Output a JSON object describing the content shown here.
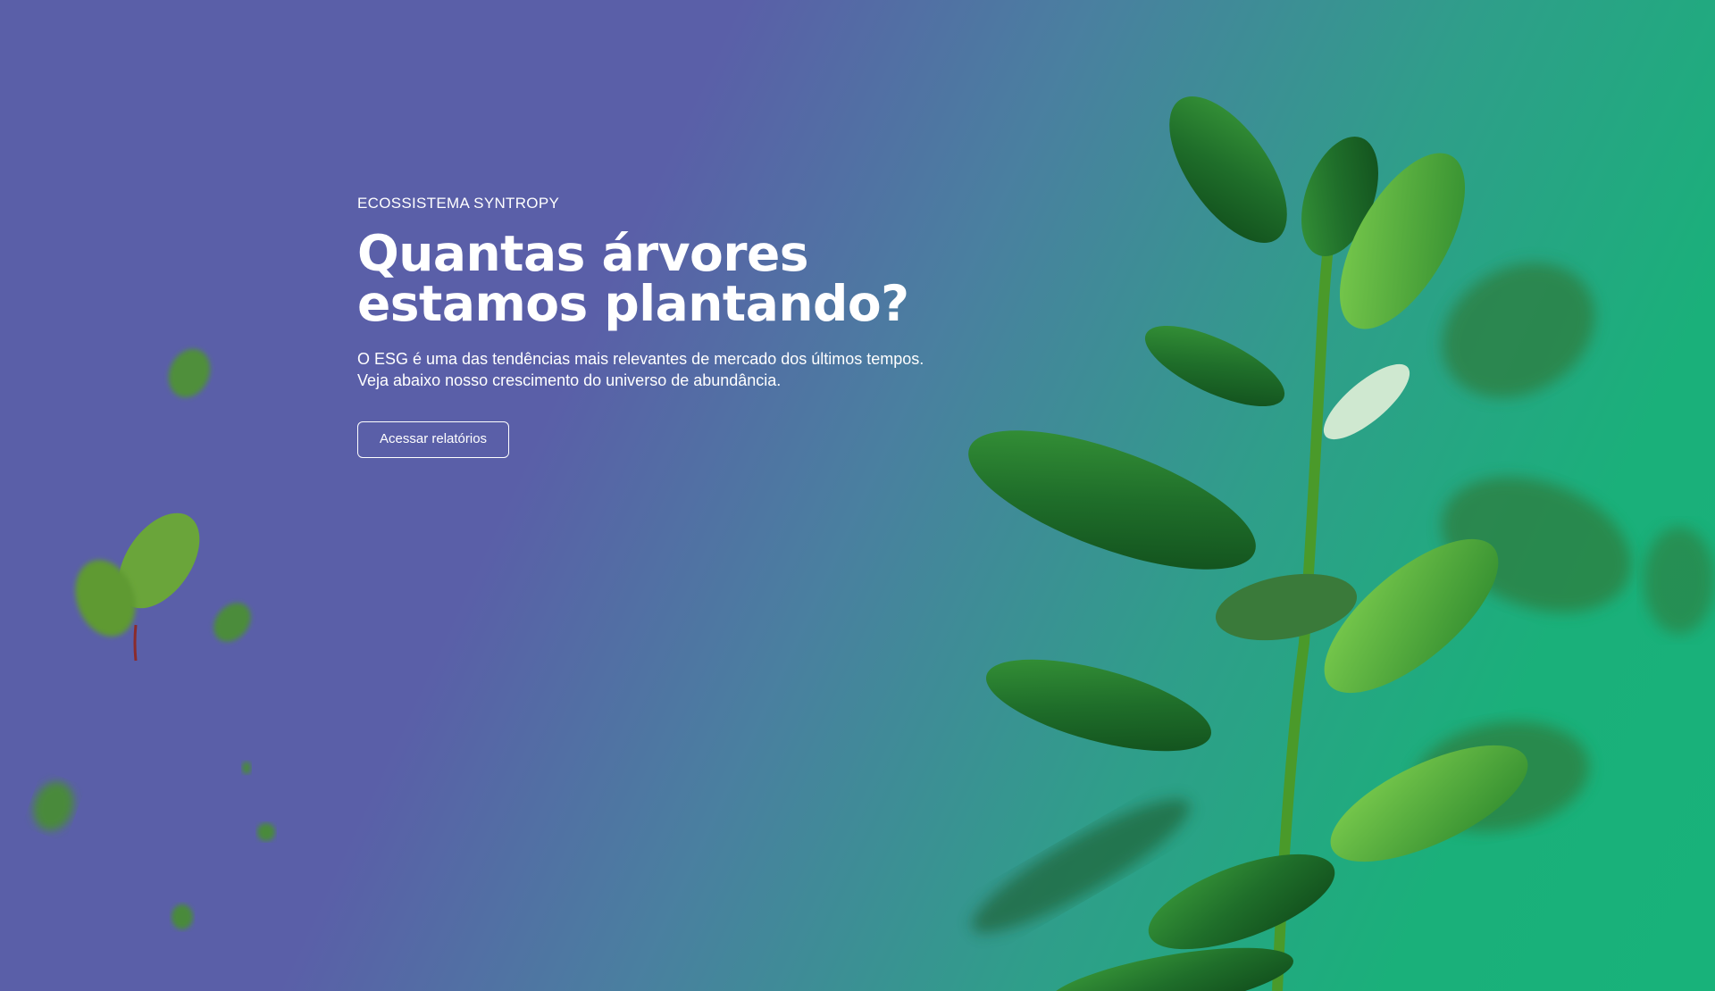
{
  "hero": {
    "eyebrow": "ECOSSISTEMA SYNTROPY",
    "title_line1": "Quantas árvores",
    "title_line2": "estamos plantando?",
    "description_line1": "O ESG é uma das tendências mais relevantes de mercado dos últimos tempos.",
    "description_line2": "Veja abaixo nosso crescimento do universo de abundância.",
    "cta_label": "Acessar relatórios"
  },
  "colors": {
    "gradient_start": "#5a5fa8",
    "gradient_end": "#18b27a",
    "text": "#ffffff",
    "leaf_dark": "#1f6e2a",
    "leaf_light": "#5bbf3f"
  },
  "icons": {
    "plant": "green-plant-illustration",
    "floating_leaves": "blurred-leaves-decoration"
  }
}
